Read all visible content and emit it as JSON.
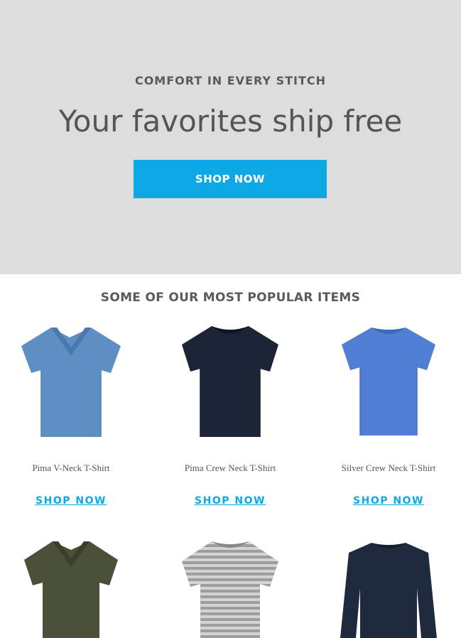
{
  "hero": {
    "eyebrow": "COMFORT IN EVERY STITCH",
    "title": "Your favorites ship free",
    "cta_label": "SHOP NOW"
  },
  "popular": {
    "heading": "SOME OF OUR MOST POPULAR ITEMS",
    "products": [
      {
        "name": "Pima V-Neck T-Shirt",
        "cta_label": "SHOP NOW",
        "color": "#5e8fc4",
        "neck": "v-neck"
      },
      {
        "name": "Pima Crew Neck T-Shirt",
        "cta_label": "SHOP NOW",
        "color": "#1c2536",
        "neck": "crew"
      },
      {
        "name": "Silver Crew Neck T-Shirt",
        "cta_label": "SHOP NOW",
        "color": "#4f7ed4",
        "neck": "crew"
      },
      {
        "color": "#4a5138",
        "neck": "v-neck"
      },
      {
        "color": "#b9b9b9",
        "neck": "crew",
        "pattern": "stripes"
      },
      {
        "color": "#1e2a3d",
        "neck": "crew",
        "sleeve": "long"
      }
    ]
  },
  "colors": {
    "hero_bg": "#dddddd",
    "accent": "#0fa8e6"
  }
}
